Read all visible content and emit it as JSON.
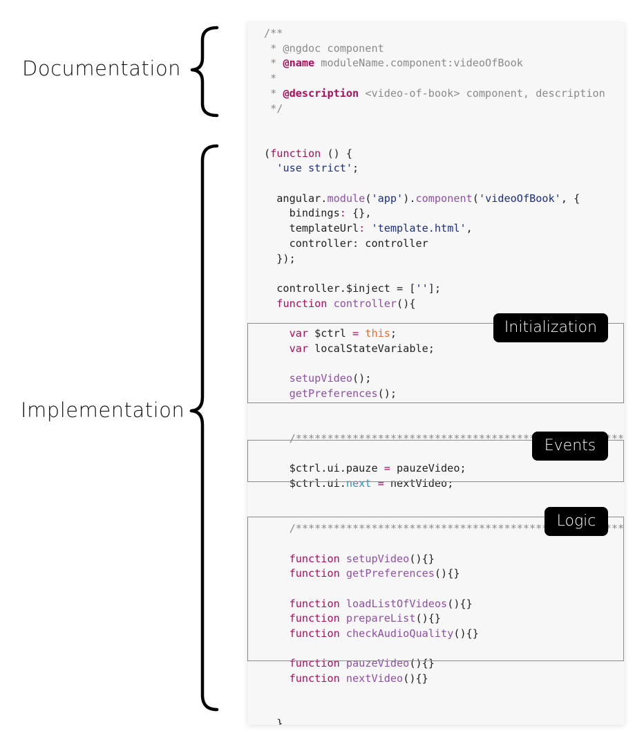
{
  "section_labels": {
    "documentation": "Documentation",
    "implementation": "Implementation"
  },
  "region_tags": {
    "initialization": "Initialization",
    "events": "Events",
    "logic": "Logic"
  },
  "colors": {
    "keyword": "#aa0d5c",
    "string": "#1a2e86",
    "method": "#8e4fa6",
    "this_keyword": "#e2702f",
    "property_blue": "#2596be",
    "comment": "#8a8a8a",
    "doc_tag": "#aa0d5c",
    "plain": "#202020"
  },
  "code_lines": [
    [
      [
        "comment",
        "/**"
      ]
    ],
    [
      [
        "comment",
        " * @ngdoc component"
      ]
    ],
    [
      [
        "comment",
        " * "
      ],
      [
        "doc_tag",
        "@name"
      ],
      [
        "comment",
        " moduleName.component:videoOfBook"
      ]
    ],
    [
      [
        "comment",
        " *"
      ]
    ],
    [
      [
        "comment",
        " * "
      ],
      [
        "doc_tag",
        "@description"
      ],
      [
        "comment",
        " <video-of-book> component, description"
      ]
    ],
    [
      [
        "comment",
        " */"
      ]
    ],
    [],
    [],
    [
      [
        "plain",
        "("
      ],
      [
        "keyword",
        "function"
      ],
      [
        "plain",
        " () {"
      ]
    ],
    [
      [
        "plain",
        "  "
      ],
      [
        "string",
        "'use strict'"
      ],
      [
        "plain",
        ";"
      ]
    ],
    [],
    [
      [
        "plain",
        "  angular."
      ],
      [
        "method",
        "module"
      ],
      [
        "plain",
        "("
      ],
      [
        "string",
        "'app'"
      ],
      [
        "plain",
        ")."
      ],
      [
        "method",
        "component"
      ],
      [
        "plain",
        "("
      ],
      [
        "string",
        "'videoOfBook'"
      ],
      [
        "plain",
        ", {"
      ]
    ],
    [
      [
        "plain",
        "    bindings"
      ],
      [
        "keyword",
        ":"
      ],
      [
        "plain",
        " {},"
      ]
    ],
    [
      [
        "plain",
        "    templateUrl"
      ],
      [
        "keyword",
        ":"
      ],
      [
        "plain",
        " "
      ],
      [
        "string",
        "'template.html'"
      ],
      [
        "plain",
        ","
      ]
    ],
    [
      [
        "plain",
        "    controller: controller"
      ]
    ],
    [
      [
        "plain",
        "  });"
      ]
    ],
    [],
    [
      [
        "plain",
        "  controller.$inject = ["
      ],
      [
        "string",
        "''"
      ],
      [
        "plain",
        "];"
      ]
    ],
    [
      [
        "plain",
        "  "
      ],
      [
        "keyword",
        "function"
      ],
      [
        "plain",
        " "
      ],
      [
        "method",
        "controller"
      ],
      [
        "plain",
        "(){"
      ]
    ],
    [],
    [
      [
        "plain",
        "    "
      ],
      [
        "keyword",
        "var"
      ],
      [
        "plain",
        " $ctrl "
      ],
      [
        "keyword",
        "="
      ],
      [
        "plain",
        " "
      ],
      [
        "this_keyword",
        "this"
      ],
      [
        "plain",
        ";"
      ]
    ],
    [
      [
        "plain",
        "    "
      ],
      [
        "keyword",
        "var"
      ],
      [
        "plain",
        " localStateVariable;"
      ]
    ],
    [],
    [
      [
        "plain",
        "    "
      ],
      [
        "method",
        "setupVideo"
      ],
      [
        "plain",
        "();"
      ]
    ],
    [
      [
        "plain",
        "    "
      ],
      [
        "method",
        "getPreferences"
      ],
      [
        "plain",
        "();"
      ]
    ],
    [],
    [],
    [
      [
        "plain",
        "    "
      ],
      [
        "comment",
        "/*****************************************************"
      ]
    ],
    [],
    [
      [
        "plain",
        "    $ctrl.ui.pauze "
      ],
      [
        "keyword",
        "="
      ],
      [
        "plain",
        " pauzeVideo;"
      ]
    ],
    [
      [
        "plain",
        "    $ctrl.ui."
      ],
      [
        "property_blue",
        "next"
      ],
      [
        "plain",
        " "
      ],
      [
        "keyword",
        "="
      ],
      [
        "plain",
        " nextVideo;"
      ]
    ],
    [],
    [],
    [
      [
        "plain",
        "    "
      ],
      [
        "comment",
        "/*****************************************************"
      ]
    ],
    [],
    [
      [
        "plain",
        "    "
      ],
      [
        "keyword",
        "function"
      ],
      [
        "plain",
        " "
      ],
      [
        "method",
        "setupVideo"
      ],
      [
        "plain",
        "(){}"
      ]
    ],
    [
      [
        "plain",
        "    "
      ],
      [
        "keyword",
        "function"
      ],
      [
        "plain",
        " "
      ],
      [
        "method",
        "getPreferences"
      ],
      [
        "plain",
        "(){}"
      ]
    ],
    [],
    [
      [
        "plain",
        "    "
      ],
      [
        "keyword",
        "function"
      ],
      [
        "plain",
        " "
      ],
      [
        "method",
        "loadListOfVideos"
      ],
      [
        "plain",
        "(){}"
      ]
    ],
    [
      [
        "plain",
        "    "
      ],
      [
        "keyword",
        "function"
      ],
      [
        "plain",
        " "
      ],
      [
        "method",
        "prepareList"
      ],
      [
        "plain",
        "(){}"
      ]
    ],
    [
      [
        "plain",
        "    "
      ],
      [
        "keyword",
        "function"
      ],
      [
        "plain",
        " "
      ],
      [
        "method",
        "checkAudioQuality"
      ],
      [
        "plain",
        "(){}"
      ]
    ],
    [],
    [
      [
        "plain",
        "    "
      ],
      [
        "keyword",
        "function"
      ],
      [
        "plain",
        " "
      ],
      [
        "method",
        "pauzeVideo"
      ],
      [
        "plain",
        "(){}"
      ]
    ],
    [
      [
        "plain",
        "    "
      ],
      [
        "keyword",
        "function"
      ],
      [
        "plain",
        " "
      ],
      [
        "method",
        "nextVideo"
      ],
      [
        "plain",
        "(){}"
      ]
    ],
    [],
    [],
    [
      [
        "plain",
        "  }"
      ]
    ],
    [],
    [],
    [
      [
        "plain",
        "}());"
      ]
    ]
  ]
}
